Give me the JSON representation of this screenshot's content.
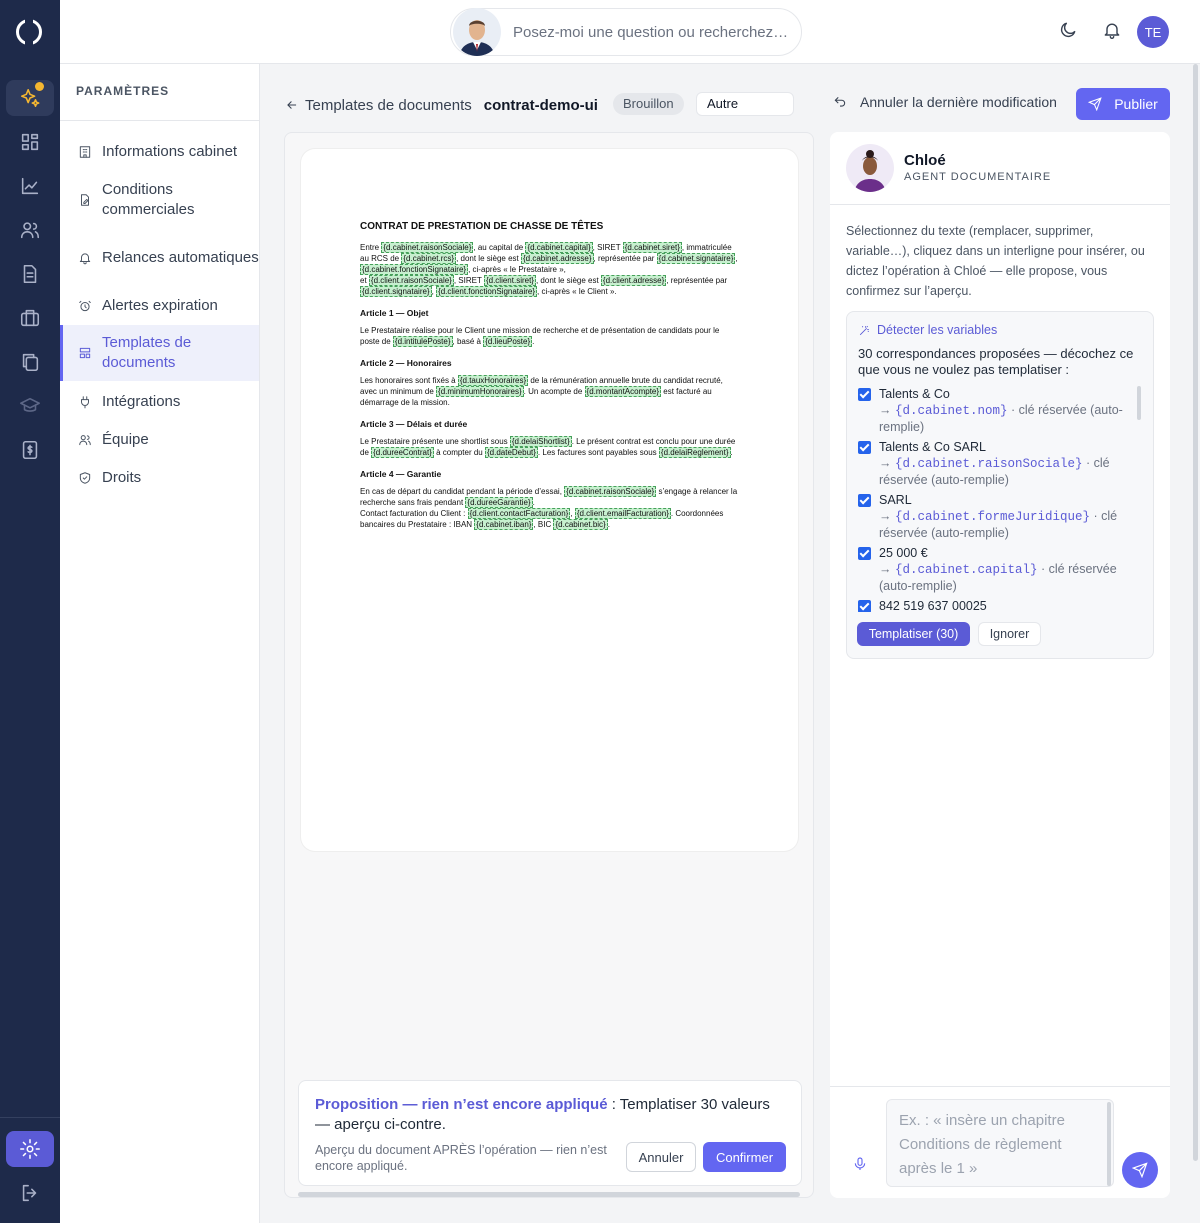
{
  "search": {
    "placeholder": "Posez-moi une question ou recherchez…"
  },
  "user": {
    "initials": "TE"
  },
  "settings": {
    "heading": "PARAMÈTRES",
    "items": [
      {
        "label": "Informations cabinet",
        "icon": "building-icon"
      },
      {
        "label": "Conditions commerciales",
        "icon": "file-edit-icon"
      },
      {
        "label": "Relances automatiques",
        "icon": "bell-icon"
      },
      {
        "label": "Alertes expiration",
        "icon": "alarm-clock-icon"
      },
      {
        "label": "Templates de documents",
        "icon": "template-icon",
        "active": true
      },
      {
        "label": "Intégrations",
        "icon": "plug-icon"
      },
      {
        "label": "Équipe",
        "icon": "users-icon"
      },
      {
        "label": "Droits",
        "icon": "shield-icon"
      }
    ]
  },
  "header": {
    "back_label": "Templates de documents",
    "doc_name": "contrat-demo-ui",
    "status": "Brouillon",
    "type": "Autre",
    "undo_label": "Annuler la dernière modification",
    "publish_label": "Publier"
  },
  "document": {
    "title": "CONTRAT DE PRESTATION DE CHASSE DE TÊTES",
    "intro": [
      {
        "t": "Entre "
      },
      {
        "v": "{d.cabinet.raisonSociale}"
      },
      {
        "t": ", au capital de "
      },
      {
        "v": "{d.cabinet.capital}"
      },
      {
        "t": ", SIRET "
      },
      {
        "v": "{d.cabinet.siret}"
      },
      {
        "t": ", immatriculée au RCS de "
      },
      {
        "v": "{d.cabinet.rcs}"
      },
      {
        "t": ", dont le siège est "
      },
      {
        "v": "{d.cabinet.adresse}"
      },
      {
        "t": ", représentée par "
      },
      {
        "v": "{d.cabinet.signataire}"
      },
      {
        "t": ", "
      },
      {
        "v": "{d.cabinet.fonctionSignataire}"
      },
      {
        "t": ", ci-après « le Prestataire »,"
      },
      {
        "br": true
      },
      {
        "t": "et "
      },
      {
        "v": "{d.client.raisonSociale}"
      },
      {
        "t": ", SIRET "
      },
      {
        "v": "{d.client.siret}"
      },
      {
        "t": ", dont le siège est "
      },
      {
        "v": "{d.client.adresse}"
      },
      {
        "t": ", représentée par "
      },
      {
        "v": "{d.client.signataire}"
      },
      {
        "t": ", "
      },
      {
        "v": "{d.client.fonctionSignataire}"
      },
      {
        "t": ", ci-après « le Client »."
      }
    ],
    "articles": [
      {
        "title": "Article 1 — Objet",
        "body": [
          {
            "t": "Le Prestataire réalise pour le Client une mission de recherche et de présentation de candidats pour le poste de "
          },
          {
            "v": "{d.intitulePoste}"
          },
          {
            "t": ", basé à "
          },
          {
            "v": "{d.lieuPoste}"
          },
          {
            "t": "."
          }
        ]
      },
      {
        "title": "Article 2 — Honoraires",
        "body": [
          {
            "t": "Les honoraires sont fixés à "
          },
          {
            "v": "{d.tauxHonoraires}"
          },
          {
            "t": " de la rémunération annuelle brute du candidat recruté, avec un minimum de "
          },
          {
            "v": "{d.minimumHonoraires}"
          },
          {
            "t": ". Un acompte de "
          },
          {
            "v": "{d.montantAcompte}"
          },
          {
            "t": " est facturé au démarrage de la mission."
          }
        ]
      },
      {
        "title": "Article 3 — Délais et durée",
        "body": [
          {
            "t": "Le Prestataire présente une shortlist sous "
          },
          {
            "v": "{d.delaiShortlist}"
          },
          {
            "t": ". Le présent contrat est conclu pour une durée de "
          },
          {
            "v": "{d.dureeContrat}"
          },
          {
            "t": " à compter du "
          },
          {
            "v": "{d.dateDebut}"
          },
          {
            "t": ". Les factures sont payables sous "
          },
          {
            "v": "{d.delaiReglement}"
          },
          {
            "t": "."
          }
        ]
      },
      {
        "title": "Article 4 — Garantie",
        "body": [
          {
            "t": "En cas de départ du candidat pendant la période d’essai, "
          },
          {
            "v": "{d.cabinet.raisonSociale}"
          },
          {
            "t": " s’engage à relancer la recherche sans frais pendant "
          },
          {
            "v": "{d.dureeGarantie}"
          },
          {
            "t": "."
          },
          {
            "br": true
          },
          {
            "t": "Contact facturation du Client : "
          },
          {
            "v": "{d.client.contactFacturation}"
          },
          {
            "t": ", "
          },
          {
            "v": "{d.client.emailFacturation}"
          },
          {
            "t": ". Coordonnées bancaires du Prestataire : IBAN "
          },
          {
            "v": "{d.cabinet.iban}"
          },
          {
            "t": ", BIC "
          },
          {
            "v": "{d.cabinet.bic}"
          },
          {
            "t": "."
          }
        ]
      }
    ]
  },
  "proposal": {
    "label": "Proposition — rien n’est encore appliqué",
    "text": " : Templatiser 30 valeurs — aperçu ci-contre.",
    "note": "Aperçu du document APRÈS l’opération — rien n’est encore appliqué.",
    "cancel_label": "Annuler",
    "confirm_label": "Confirmer"
  },
  "agent": {
    "name": "Chloé",
    "role": "AGENT DOCUMENTAIRE",
    "intro": "Sélectionnez du texte (remplacer, supprimer, variable…), cliquez dans un interligne pour insérer, ou dictez l’opération à Chloé — elle propose, vous confirmez sur l’aperçu.",
    "detect_label": "Détecter les variables",
    "detect_text": "30 correspondances proposées — décochez ce que vous ne voulez pas templatiser :",
    "matches": [
      {
        "value": "Talents & Co",
        "key": "{d.cabinet.nom}",
        "note": " · clé réservée (auto-remplie)",
        "checked": true
      },
      {
        "value": "Talents & Co SARL",
        "key": "{d.cabinet.raisonSociale}",
        "note": " · clé réservée (auto-remplie)",
        "checked": true
      },
      {
        "value": "SARL",
        "key": "{d.cabinet.formeJuridique}",
        "note": " · clé réservée (auto-remplie)",
        "checked": true
      },
      {
        "value": "25 000 €",
        "key": "{d.cabinet.capital}",
        "note": " · clé réservée (auto-remplie)",
        "checked": true
      },
      {
        "value": "842 519 637 00025",
        "key": "",
        "note": "",
        "checked": true
      }
    ],
    "templatize_label": "Templatiser (30)",
    "ignore_label": "Ignorer",
    "chat_placeholder": "Ex. : « insère un chapitre Conditions de règlement après le 1 »"
  }
}
